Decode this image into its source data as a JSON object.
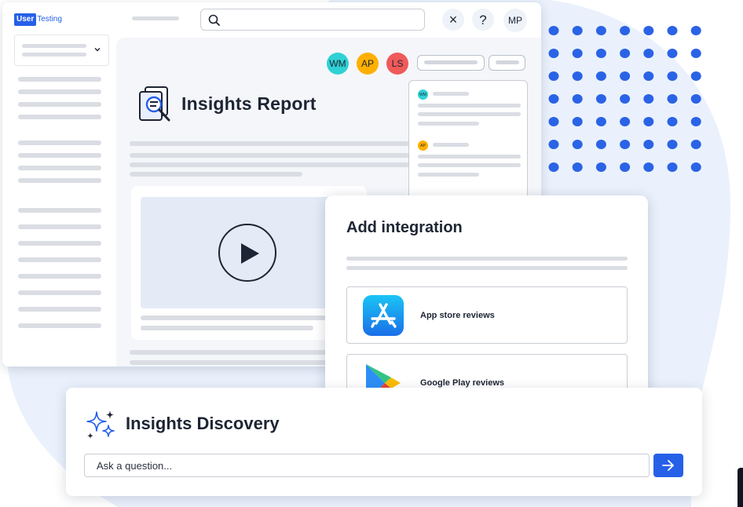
{
  "brand": {
    "logo_user": "User",
    "logo_testing": "Testing",
    "accent": "#2660e8",
    "avatar_colors": {
      "WM": "#2fd1d4",
      "AP": "#ffb000",
      "LS": "#f05a5a"
    }
  },
  "toolbar": {
    "search_placeholder": "",
    "close_label": "×",
    "help_label": "?",
    "user_initials": "MP"
  },
  "collaborators": [
    "WM",
    "AP",
    "LS"
  ],
  "report": {
    "title": "Insights Report"
  },
  "comments": {
    "items": [
      {
        "initials": "WM"
      },
      {
        "initials": "AP"
      }
    ]
  },
  "integration_dialog": {
    "title": "Add integration",
    "options": [
      {
        "label": "App store reviews",
        "icon": "app-store-icon"
      },
      {
        "label": "Google Play reviews",
        "icon": "google-play-icon"
      }
    ]
  },
  "discovery": {
    "title": "Insights Discovery",
    "input_placeholder": "Ask a question...",
    "send_icon": "arrow-right-icon"
  }
}
